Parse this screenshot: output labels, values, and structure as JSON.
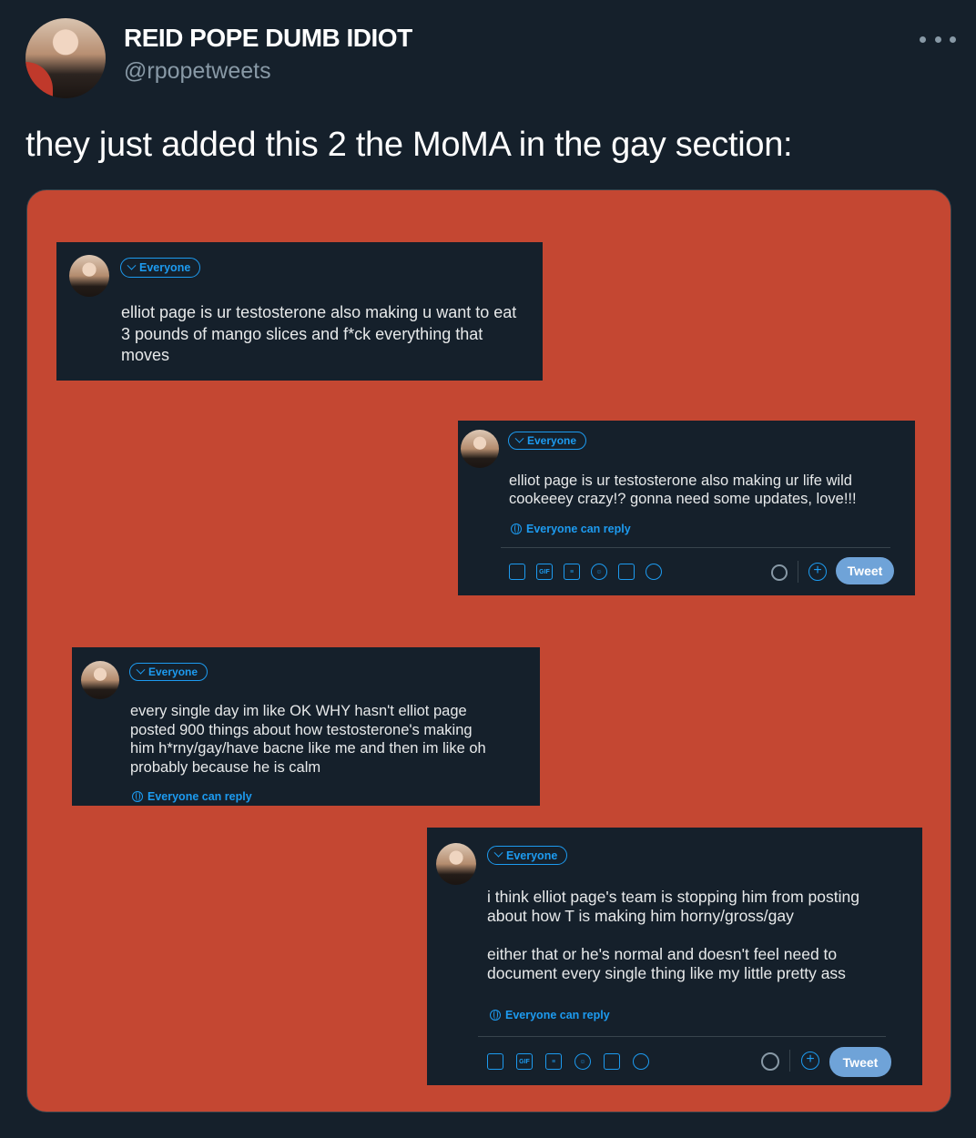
{
  "author": {
    "name": "REID POPE DUMB IDIOT",
    "handle": "@rpopetweets"
  },
  "tweet": {
    "text": "they just added this 2 the MoMA in the gay section:"
  },
  "screenshots": [
    {
      "audience": "Everyone",
      "text": "elliot page is ur testosterone also making u want to eat\n3 pounds of mango slices and f*ck everything that\nmoves"
    },
    {
      "audience": "Everyone",
      "text": "elliot page is ur testosterone also making ur life wild\ncookeeey crazy!? gonna need some updates, love!!!",
      "reply_setting": "Everyone can reply",
      "tweet_button": "Tweet"
    },
    {
      "audience": "Everyone",
      "text": "every single day im like OK WHY hasn't elliot page\nposted 900 things about how testosterone's making\nhim h*rny/gay/have bacne like me and then im like oh\nprobably because he is calm",
      "reply_setting": "Everyone can reply"
    },
    {
      "audience": "Everyone",
      "text": "i think elliot page's team is stopping him from posting\nabout how T is making him horny/gross/gay\n\neither that or he's normal and doesn't feel need to\ndocument every single thing like my little pretty ass",
      "reply_setting": "Everyone can reply",
      "tweet_button": "Tweet"
    }
  ],
  "toolbar_icons": [
    "image-icon",
    "gif-icon",
    "poll-icon",
    "emoji-icon",
    "schedule-icon",
    "location-icon"
  ],
  "colors": {
    "background": "#15202b",
    "media_background": "#c44732",
    "accent": "#1d9bf0",
    "tweet_button": "#6fa3d8"
  }
}
